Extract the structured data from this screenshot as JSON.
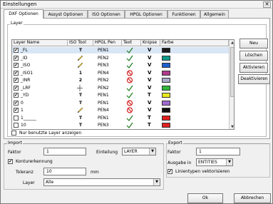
{
  "window": {
    "title": "Einstellungen",
    "close_glyph": "✕"
  },
  "tabs": [
    {
      "label": "DXF Optionen",
      "active": true
    },
    {
      "label": "Assyst Optionen"
    },
    {
      "label": "ISO Optionen"
    },
    {
      "label": "HPGL Optionen"
    },
    {
      "label": "Funktionen"
    },
    {
      "label": "Allgemein"
    }
  ],
  "layer": {
    "group_label": "Layer",
    "columns": [
      "Layer Name",
      "ISO Tool",
      "HPGL Pen",
      "Text",
      "Knipse",
      "Farbe"
    ],
    "rows": [
      {
        "checked": true,
        "name": "_FL",
        "tool": "T",
        "tool_icon": "t-tool-icon",
        "pen": "PEN1",
        "text": "check",
        "knipse": "V",
        "color": "#1a1a1a"
      },
      {
        "checked": true,
        "name": "_ID",
        "tool": "",
        "tool_icon": "pencil-icon",
        "pen": "PEN2",
        "text": "check",
        "knipse": "V",
        "color": "#0f9a8a"
      },
      {
        "checked": true,
        "name": "_ISO",
        "tool": "",
        "tool_icon": "pencil-icon",
        "pen": "PEN3",
        "text": "check",
        "knipse": "V",
        "color": "#1f5fd0"
      },
      {
        "checked": true,
        "name": "_ISO1",
        "tool": "1",
        "tool_icon": "number-tool-icon",
        "pen": "PEN4",
        "text": "forbidden",
        "knipse": "V",
        "color": "#b23a8c"
      },
      {
        "checked": true,
        "name": "_INR",
        "tool": "2",
        "tool_icon": "number-tool-icon",
        "pen": "PEN2",
        "text": "forbidden",
        "knipse": "V",
        "color": "#a8a8c8"
      },
      {
        "checked": true,
        "name": "_LRF",
        "tool": "",
        "tool_icon": "cross-tool-icon",
        "pen": "PEN2",
        "text": "check",
        "knipse": "V",
        "color": "#2fb83a"
      },
      {
        "checked": true,
        "name": "_YD",
        "tool": "T",
        "tool_icon": "t-tool-icon",
        "pen": "PEN1",
        "text": "check",
        "knipse": "T",
        "color": "#e8e820"
      },
      {
        "checked": true,
        "name": "0",
        "tool": "T",
        "tool_icon": "t-tool-icon",
        "pen": "PEN1",
        "text": "forbidden",
        "knipse": "V",
        "color": "#a06ad0"
      },
      {
        "checked": true,
        "name": "1",
        "tool": "",
        "tool_icon": "pencil-icon",
        "pen": "PEN4",
        "text": "forbidden",
        "knipse": "V",
        "color": "#111111"
      },
      {
        "checked": false,
        "name": "1______",
        "tool": "T",
        "tool_icon": "t-tool-icon",
        "pen": "PEN1",
        "text": "check",
        "knipse": "T",
        "color": "#e02020"
      },
      {
        "checked": false,
        "name": "10",
        "tool": "T",
        "tool_icon": "t-tool-icon",
        "pen": "PEN3",
        "text": "check",
        "knipse": "T",
        "color": "#e02020"
      }
    ],
    "only_used_label": "Nur benutzte Layer anzeigen",
    "buttons": {
      "new": "Neu",
      "delete": "Löschen",
      "activate": "Aktivieren",
      "deactivate": "Deaktivieren"
    }
  },
  "import": {
    "label": "Import",
    "factor_label": "Faktor",
    "factor_value": "1",
    "division_label": "Einteilung",
    "division_value": "LAYER",
    "contour_label": "Konturerkennung",
    "contour_checked": true,
    "tolerance_label": "Toleranz",
    "tolerance_value": "10",
    "tolerance_unit": "mm",
    "layer_label": "Layer",
    "layer_value": "Alle"
  },
  "export": {
    "label": "Export",
    "factor_label": "Faktor",
    "factor_value": "1",
    "output_label": "Ausgabe in",
    "output_value": "ENTITIES",
    "vectorize_label": "Linientypen vektorisieren",
    "vectorize_checked": true
  },
  "footer": {
    "ok": "Ok",
    "cancel": "Abbrechen"
  },
  "glyphs": {
    "check": "✔",
    "dropdown": "▼",
    "scroll_up": "▲",
    "scroll_down": "▼"
  }
}
